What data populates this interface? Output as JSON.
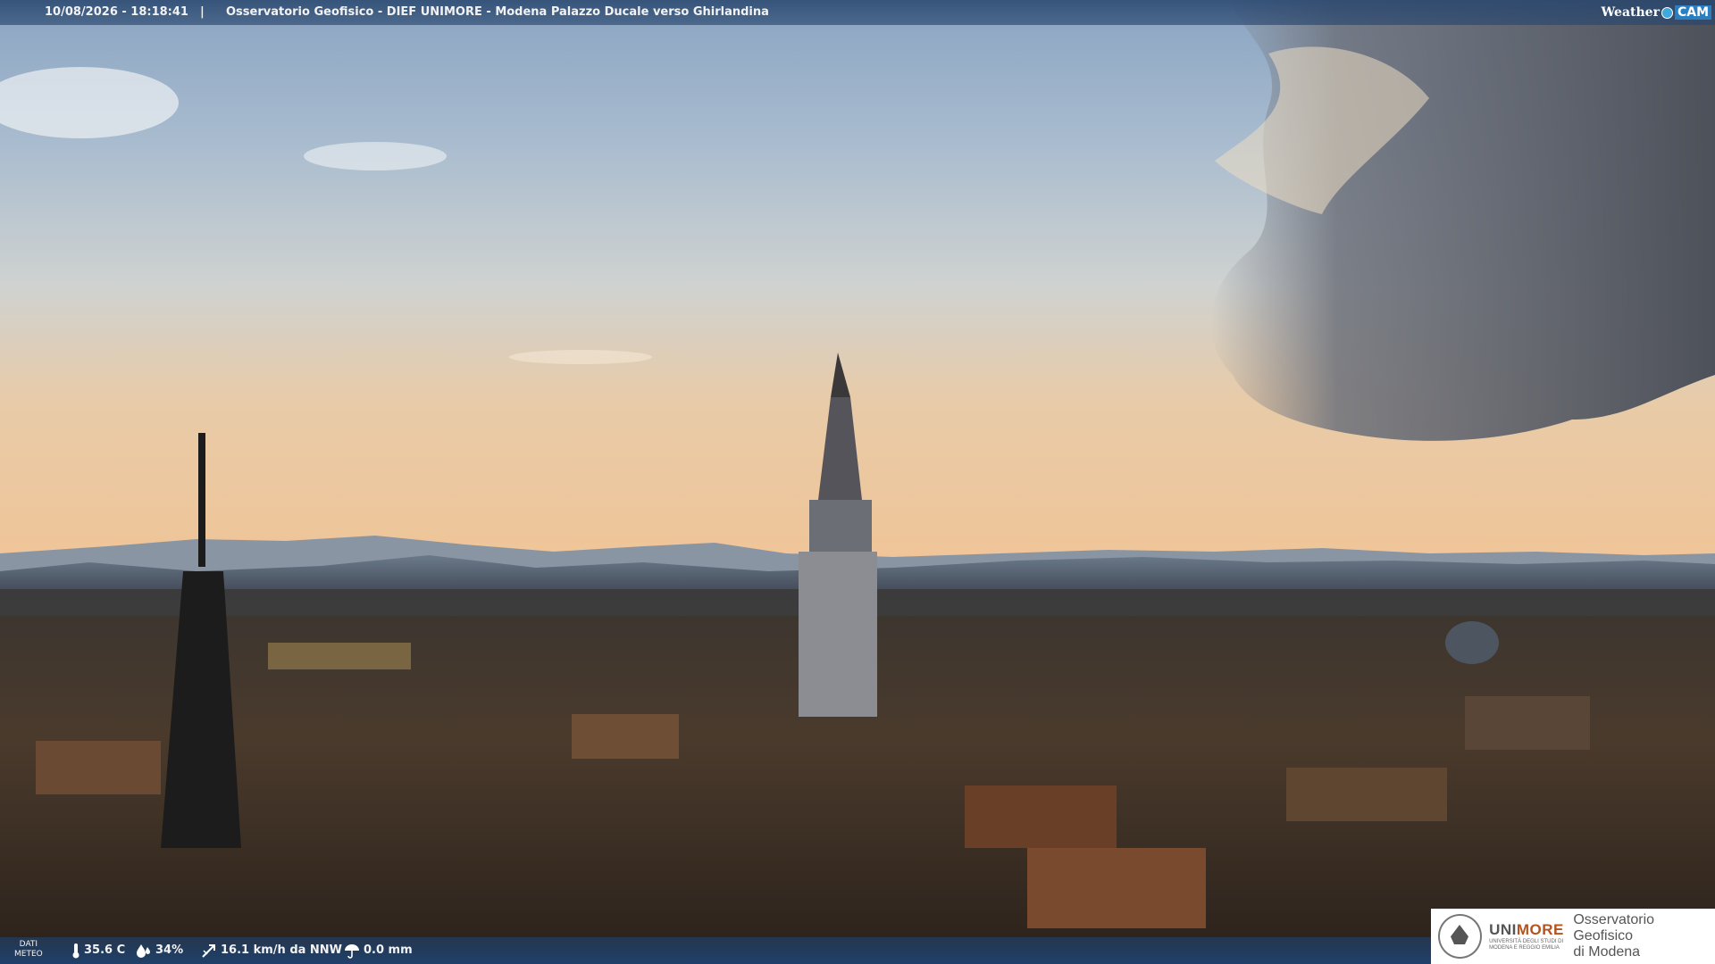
{
  "header": {
    "timestamp": "10/08/2026 - 18:18:41",
    "separator": "|",
    "title": "Osservatorio Geofisico - DIEF UNIMORE - Modena Palazzo Ducale verso Ghirlandina",
    "logo_left": "Weather",
    "logo_right": "CAM"
  },
  "footer": {
    "dati_label_line1": "DATI",
    "dati_label_line2": "METEO",
    "temperature": "35.6 C",
    "humidity": "34%",
    "wind": "16.1 km/h da NNW",
    "rain": "0.0 mm"
  },
  "branding": {
    "uni_prefix": "UNI",
    "uni_suffix": "MORE",
    "uni_sub_line1": "UNIVERSITÀ DEGLI STUDI DI",
    "uni_sub_line2": "MODENA E REGGIO EMILIA",
    "obs_line1": "Osservatorio Geofisico",
    "obs_line2": "di Modena"
  },
  "colors": {
    "accent": "#2a7fc0",
    "brand_orange": "#b5531f"
  }
}
